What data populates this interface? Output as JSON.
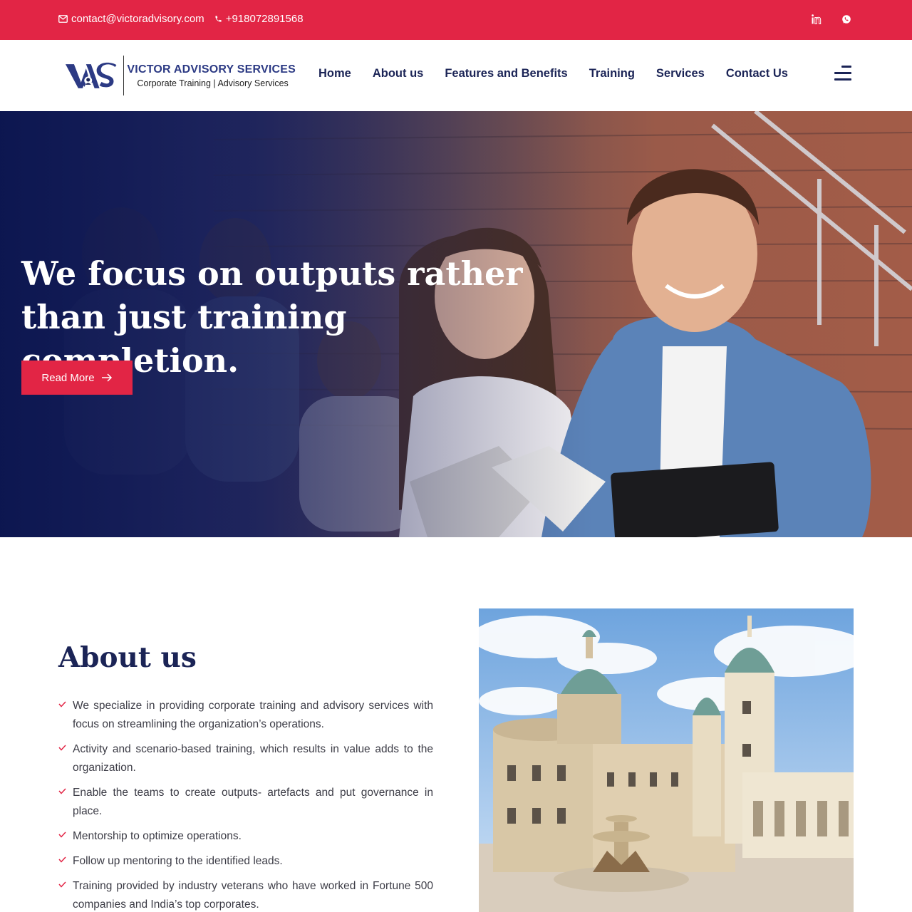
{
  "topbar": {
    "email": "contact@victoradvisory.com",
    "phone": "+918072891568",
    "social": [
      "linkedin-icon",
      "whatsapp-icon"
    ]
  },
  "header": {
    "logo_mark": "VAS",
    "brand": "VICTOR ADVISORY SERVICES",
    "tagline": "Corporate Training | Advisory Services",
    "nav": [
      "Home",
      "About us",
      "Features and Benefits",
      "Training",
      "Services",
      "Contact Us"
    ],
    "menu_icon": "hamburger-icon"
  },
  "hero": {
    "headline_line1": "We focus on outputs rather",
    "headline_line2": "than just training completion.",
    "button": "Read More"
  },
  "about": {
    "title": "About us",
    "items": [
      "We specialize in providing corporate training and advisory services with focus on streamlining the organization’s operations.",
      "Activity and scenario-based training, which results in value adds to the organization.",
      "Enable the teams to create outputs- artefacts and put governance in place.",
      "Mentorship to optimize operations.",
      "Follow up mentoring to the identified leads.",
      "Training provided by industry veterans who have worked in Fortune 500 companies and India’s top corporates."
    ]
  },
  "colors": {
    "accent": "#e22545",
    "navy": "#1b2456",
    "brand_blue": "#2c3a84"
  }
}
